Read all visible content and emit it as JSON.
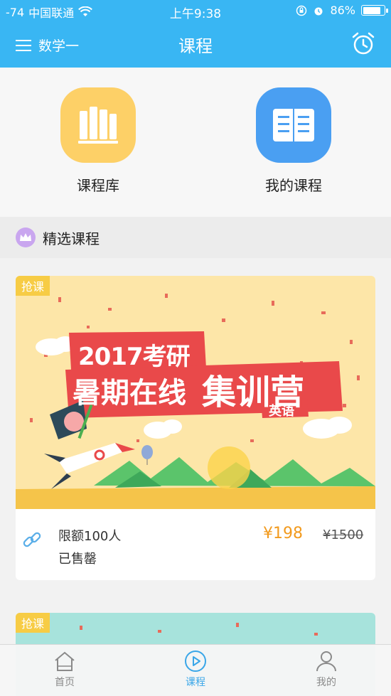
{
  "status": {
    "signal": "-74",
    "carrier": "中国联通",
    "time": "上午9:38",
    "battery": "86%",
    "battery_level": 0.86
  },
  "nav": {
    "subject": "数学一",
    "title": "课程"
  },
  "quick": {
    "library_label": "课程库",
    "my_courses_label": "我的课程"
  },
  "section": {
    "title": "精选课程"
  },
  "courses": [
    {
      "tag": "抢课",
      "banner_title_line1": "2017考研",
      "banner_title_line2a": "暑期在线",
      "banner_title_line2b": "集训营",
      "banner_subject": "英语",
      "quota": "限额100人",
      "status": "已售罄",
      "price": "¥198",
      "original_price": "¥1500"
    },
    {
      "tag": "抢课"
    }
  ],
  "tabs": [
    {
      "label": "首页",
      "active": false
    },
    {
      "label": "课程",
      "active": true
    },
    {
      "label": "我的",
      "active": false
    }
  ],
  "colors": {
    "primary": "#39b6f3",
    "price": "#f29a1d",
    "tag": "#f7cc45",
    "library_icon": "#fdd067",
    "my_courses_icon": "#4a9ff2"
  }
}
